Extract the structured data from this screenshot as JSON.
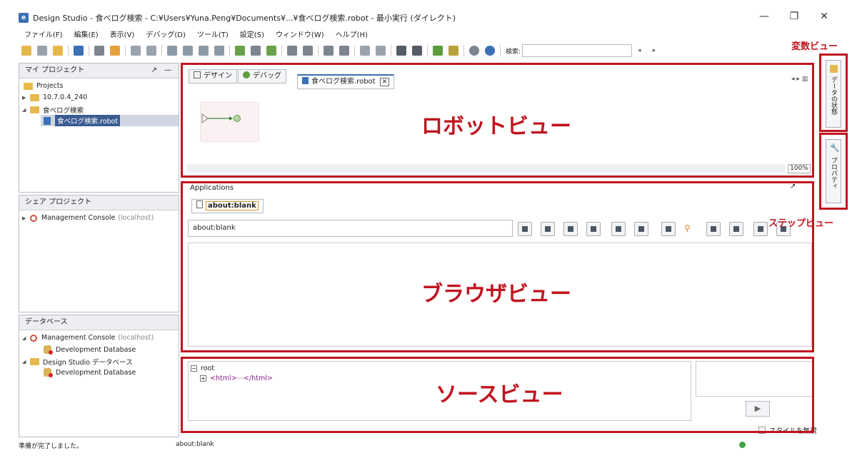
{
  "window": {
    "title": "Design Studio - 食べログ検索 - C:¥Users¥Yuna.Peng¥Documents¥...¥食べログ検索.robot - 最小実行 (ダイレクト)",
    "app_icon_letter": "e",
    "minimize": "—",
    "restore": "❐",
    "close": "✕"
  },
  "menu": [
    "ファイル(F)",
    "編集(E)",
    "表示(V)",
    "デバッグ(D)",
    "ツール(T)",
    "設定(S)",
    "ウィンドウ(W)",
    "ヘルプ(H)"
  ],
  "toolbar": {
    "search_label": "検索:",
    "search_value": "",
    "prev": "◂",
    "next": "▸"
  },
  "my_project": {
    "title": "マイ プロジェクト",
    "root": "Projects",
    "items": [
      "10.7.0.4_240",
      "食べログ検索",
      "食べログ検索.robot"
    ]
  },
  "shared_project": {
    "title": "シェア プロジェクト",
    "item": "Management Console",
    "item_host": "(localhost)"
  },
  "database": {
    "title": "データベース",
    "mc": "Management Console",
    "mc_host": "(localhost)",
    "dev_db_1": "Development Database",
    "ds_db": "Design Studio データベース",
    "dev_db_2": "Development Database"
  },
  "robot_view": {
    "tab_design": "デザイン",
    "tab_debug": "デバッグ",
    "file_tab": "食べログ検索.robot",
    "zoom": "100%",
    "label": "ロボットビュー"
  },
  "browser_view": {
    "section": "Applications",
    "tab": "about:blank",
    "address": "about:blank",
    "label": "ブラウザビュー"
  },
  "source_view": {
    "root": "root",
    "html_node": "<html>⋯</html>",
    "label": "ソースビュー",
    "ignore_style": "スタイルを無視"
  },
  "side_tabs": {
    "data_state": "データの状態",
    "properties": "プロパティ"
  },
  "annotations": {
    "variables_view": "変数ビュー",
    "step_view": "ステップビュー"
  },
  "status": {
    "left": "準備が完了しました。",
    "middle": "about:blank",
    "dot_color": "#3ea33e"
  },
  "colors": {
    "accent_red": "#c0141f"
  }
}
